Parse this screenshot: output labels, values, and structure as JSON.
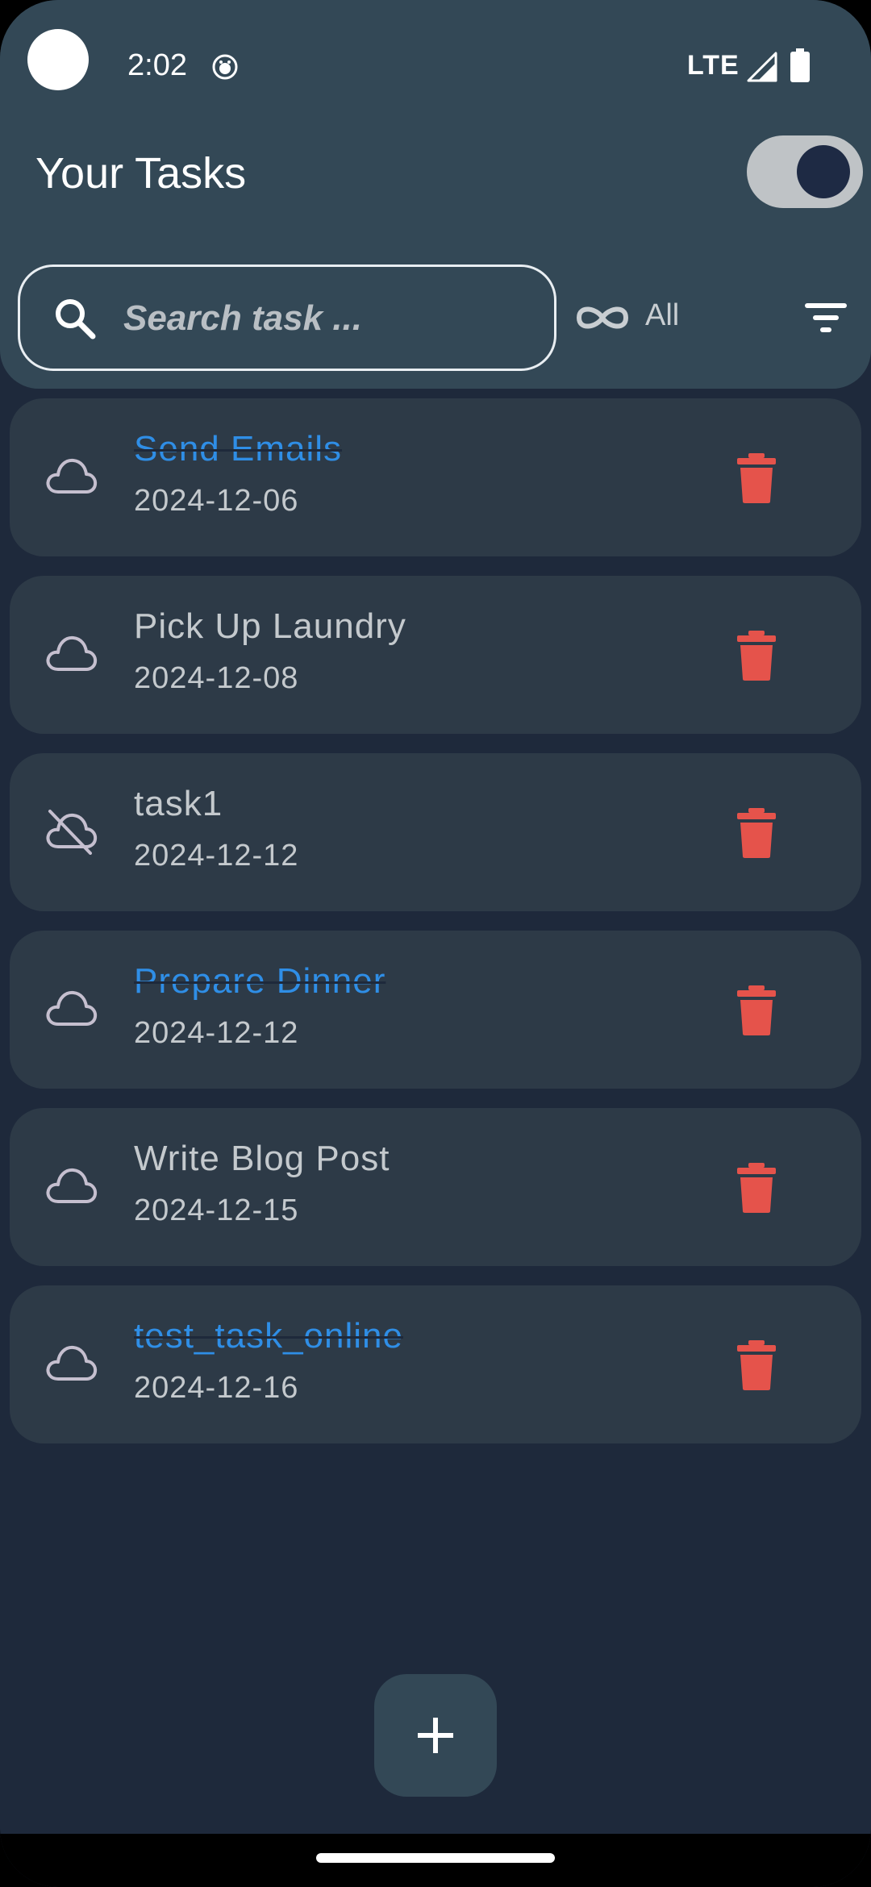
{
  "status_bar": {
    "time": "2:02",
    "network": "LTE",
    "icons": [
      "notification-icon",
      "signal-icon",
      "battery-icon"
    ]
  },
  "app_bar": {
    "title": "Your Tasks",
    "toggle_on": true
  },
  "search": {
    "placeholder": "Search task ...",
    "value": ""
  },
  "filter": {
    "label": "All",
    "icon": "infinity-icon"
  },
  "tasks": [
    {
      "title": "Send Emails",
      "date": "2024-12-06",
      "completed": true,
      "synced": true
    },
    {
      "title": "Pick Up Laundry",
      "date": "2024-12-08",
      "completed": false,
      "synced": true
    },
    {
      "title": "task1",
      "date": "2024-12-12",
      "completed": false,
      "synced": false
    },
    {
      "title": "Prepare Dinner",
      "date": "2024-12-12",
      "completed": true,
      "synced": true
    },
    {
      "title": "Write Blog Post",
      "date": "2024-12-15",
      "completed": false,
      "synced": true
    },
    {
      "title": "test_task_online",
      "date": "2024-12-16",
      "completed": true,
      "synced": true
    }
  ],
  "colors": {
    "background": "#1e293b",
    "header": "#334856",
    "card": "#2d3a47",
    "completed_title": "#2f8ee6",
    "delete": "#e5534b",
    "text": "#c4c9cd"
  },
  "fab": {
    "icon": "plus-icon"
  }
}
